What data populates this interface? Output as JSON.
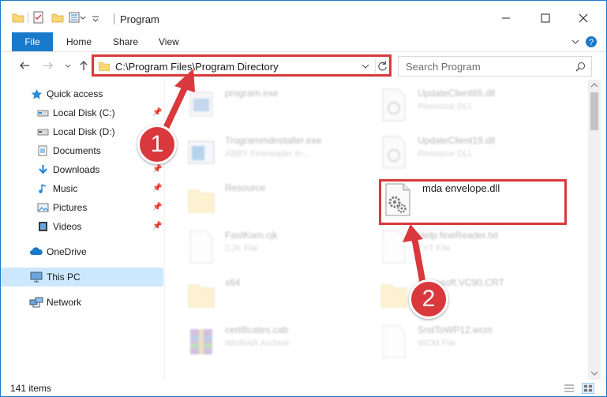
{
  "window": {
    "title": "Program",
    "controls": {
      "minimize": "minimize-icon",
      "maximize": "maximize-icon",
      "close": "close-icon"
    },
    "accent": "#1979ca"
  },
  "ribbon": {
    "tabs": [
      {
        "label": "File"
      },
      {
        "label": "Home"
      },
      {
        "label": "Share"
      },
      {
        "label": "View"
      }
    ]
  },
  "address": {
    "path": "C:\\Program Files\\Program Directory",
    "search_placeholder": "Search Program"
  },
  "sidebar": {
    "items": [
      {
        "label": "Quick access",
        "icon": "star-icon",
        "pinned": false
      },
      {
        "label": "Local Disk (C:)",
        "icon": "drive-icon",
        "pinned": true
      },
      {
        "label": "Local Disk (D:)",
        "icon": "drive-icon",
        "pinned": false
      },
      {
        "label": "Documents",
        "icon": "documents-icon",
        "pinned": false
      },
      {
        "label": "Downloads",
        "icon": "download-icon",
        "pinned": true
      },
      {
        "label": "Music",
        "icon": "music-icon",
        "pinned": true
      },
      {
        "label": "Pictures",
        "icon": "pictures-icon",
        "pinned": true
      },
      {
        "label": "Videos",
        "icon": "videos-icon",
        "pinned": true
      },
      {
        "label": "OneDrive",
        "icon": "cloud-icon",
        "pinned": false
      },
      {
        "label": "This PC",
        "icon": "computer-icon",
        "pinned": false,
        "selected": true
      },
      {
        "label": "Network",
        "icon": "network-icon",
        "pinned": false
      }
    ]
  },
  "files": [
    {
      "name": "program.exe",
      "desc": "",
      "icon": "exe-icon"
    },
    {
      "name": "UpdateClient65.dll",
      "desc": "Resource DLL",
      "icon": "dll-icon"
    },
    {
      "name": "Trogrammdnstaller.exe",
      "desc": "ABBY Finereader tn...",
      "icon": "installer-icon"
    },
    {
      "name": "UpdateClient19.dll",
      "desc": "Resource DLL",
      "icon": "dll-icon"
    },
    {
      "name": "Resource",
      "desc": "",
      "icon": "folder-icon"
    },
    {
      "name": "mda envelope.dll",
      "desc": "",
      "icon": "dll-gear-icon"
    },
    {
      "name": "FastKorn.cjk",
      "desc": "CJK File",
      "icon": "file-icon"
    },
    {
      "name": "Help.fineReader.txt",
      "desc": "TXT File",
      "icon": "file-icon"
    },
    {
      "name": "x64",
      "desc": "",
      "icon": "folder-icon"
    },
    {
      "name": "Microsoft.VC90.CRT",
      "desc": "",
      "icon": "folder-icon"
    },
    {
      "name": "certificates.cab",
      "desc": "WinRAR Archive",
      "icon": "archive-icon"
    },
    {
      "name": "SndToWP12.wcm",
      "desc": "WCM File",
      "icon": "file-icon"
    }
  ],
  "status": {
    "count": "141 items"
  },
  "callouts": [
    {
      "label": "1"
    },
    {
      "label": "2"
    }
  ],
  "highlight_color": "#d9383c"
}
